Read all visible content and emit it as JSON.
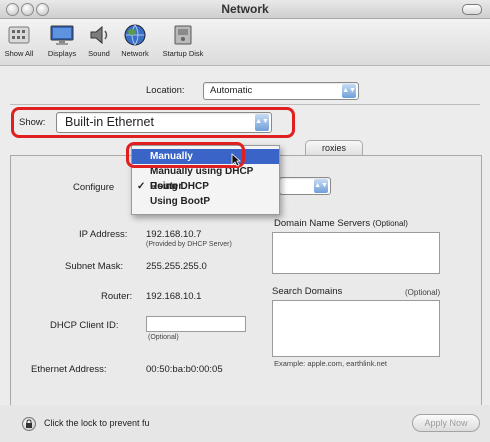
{
  "window": {
    "title": "Network"
  },
  "toolbar": {
    "items": [
      {
        "label": "Show All",
        "icon": "show-all-icon"
      },
      {
        "label": "Displays",
        "icon": "displays-icon"
      },
      {
        "label": "Sound",
        "icon": "sound-icon"
      },
      {
        "label": "Network",
        "icon": "network-icon"
      },
      {
        "label": "Startup Disk",
        "icon": "startup-disk-icon"
      }
    ]
  },
  "location": {
    "label": "Location:",
    "value": "Automatic"
  },
  "show": {
    "label": "Show:",
    "value": "Built-in Ethernet"
  },
  "tabs": {
    "proxies": "roxies"
  },
  "tcpip": {
    "configure_label": "Configure",
    "dns_label": "Domain Name Servers",
    "dns_hint": "(Optional)",
    "ip_label": "IP Address:",
    "ip_value": "192.168.10.7",
    "ip_note": "(Provided by DHCP Server)",
    "subnet_label": "Subnet Mask:",
    "subnet_value": "255.255.255.0",
    "search_label": "Search Domains",
    "search_hint": "(Optional)",
    "router_label": "Router:",
    "router_value": "192.168.10.1",
    "dhcp_label": "DHCP Client ID:",
    "dhcp_value": "",
    "dhcp_note": "(Optional)",
    "example": "Example: apple.com, earthlink.net",
    "ethernet_label": "Ethernet Address:",
    "ethernet_value": "00:50:ba:b0:00:05"
  },
  "configure_menu": {
    "items": [
      {
        "label": "Manually",
        "selected": true,
        "checked": false
      },
      {
        "label": "Manually using DHCP Router",
        "selected": false,
        "checked": false
      },
      {
        "label": "Using DHCP",
        "selected": false,
        "checked": true
      },
      {
        "label": "Using BootP",
        "selected": false,
        "checked": false
      }
    ]
  },
  "footer": {
    "lock_text": "Click the lock to prevent fu",
    "apply_label": "Apply Now"
  },
  "colors": {
    "highlight": "#e02020",
    "menu_selection": "#3a64c8"
  }
}
